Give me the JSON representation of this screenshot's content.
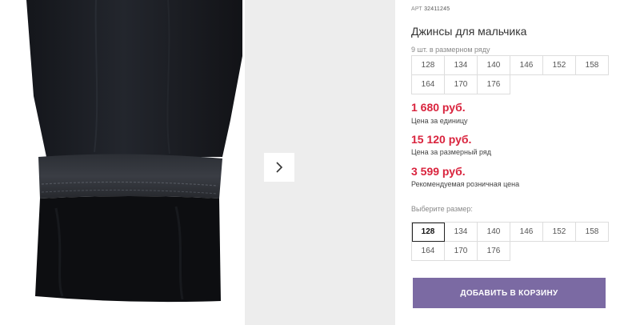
{
  "product": {
    "article_label": "АРТ",
    "article_number": "32411245",
    "title": "Джинсы для мальчика",
    "image_icon": "jeans-cuff-photo"
  },
  "size_run": {
    "caption": "9 шт. в размерном ряду",
    "sizes": [
      "128",
      "134",
      "140",
      "146",
      "152",
      "158",
      "164",
      "170",
      "176"
    ]
  },
  "prices": [
    {
      "value": "1 680 руб.",
      "label": "Цена за единицу"
    },
    {
      "value": "15 120 руб.",
      "label": "Цена за размерный ряд"
    },
    {
      "value": "3 599 руб.",
      "label": "Рекомендуемая розничная цена"
    }
  ],
  "size_select": {
    "caption": "Выберите размер:",
    "options": [
      "128",
      "134",
      "140",
      "146",
      "152",
      "158",
      "164",
      "170",
      "176"
    ],
    "selected": "128"
  },
  "cart": {
    "button_label": "ДОБАВИТЬ В КОРЗИНУ"
  },
  "gallery": {
    "next_icon": "chevron-right-icon"
  },
  "colors": {
    "price_red": "#d9233d",
    "button_purple": "#7b6aa3",
    "slide_background": "#ededed"
  }
}
